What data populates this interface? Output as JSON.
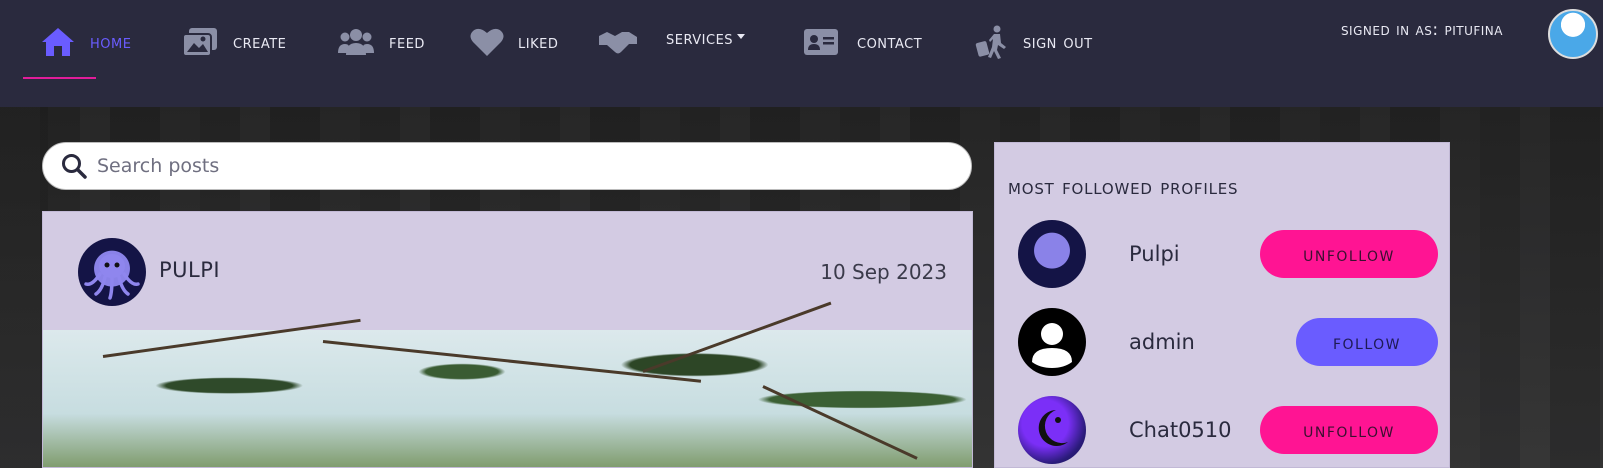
{
  "nav": {
    "items": [
      {
        "label": "Home",
        "icon": "home-icon",
        "active": true
      },
      {
        "label": "Create",
        "icon": "images-icon"
      },
      {
        "label": "Feed",
        "icon": "users-icon"
      },
      {
        "label": "Liked",
        "icon": "heart-icon"
      },
      {
        "label": "",
        "icon": "handshake-icon"
      },
      {
        "label": "Services",
        "icon": "",
        "dropdown": true
      },
      {
        "label": "Contact",
        "icon": "address-card-icon"
      },
      {
        "label": "Sign Out",
        "icon": "person-walking-luggage-icon"
      }
    ],
    "signed_in_label": "Signed in as: Pitufina",
    "active_color": "#6a5cff",
    "underline_color": "#e11d9a"
  },
  "search": {
    "placeholder": "Search posts",
    "value": ""
  },
  "post": {
    "author": "PULPI",
    "date": "10 Sep 2023"
  },
  "sidebar": {
    "title": "Most Followed Profiles",
    "profiles": [
      {
        "name": "Pulpi",
        "action": "Unfollow",
        "avatar": "octopus-avatar"
      },
      {
        "name": "admin",
        "action": "Follow",
        "avatar": "default-user-avatar"
      },
      {
        "name": "Chat0510",
        "action": "Unfollow",
        "avatar": "moon-girl-avatar"
      }
    ]
  },
  "colors": {
    "unfollow": "#ff1493",
    "follow": "#6a5cff",
    "card": "#d3cbe3",
    "navbar": "#2a2a3e"
  }
}
